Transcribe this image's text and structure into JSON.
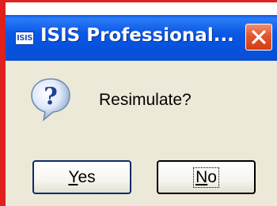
{
  "window": {
    "title": "ISIS Professional...",
    "app_icon_text": "ISIS"
  },
  "dialog": {
    "message": "Resimulate?",
    "icon": "question-icon"
  },
  "buttons": {
    "yes_accel": "Y",
    "yes_rest": "es",
    "no_accel": "N",
    "no_rest": "o"
  },
  "colors": {
    "titlebar": "#0a5be9",
    "close_button": "#d63d10",
    "dialog_background": "#ece9d8",
    "frame": "#e0201c"
  }
}
